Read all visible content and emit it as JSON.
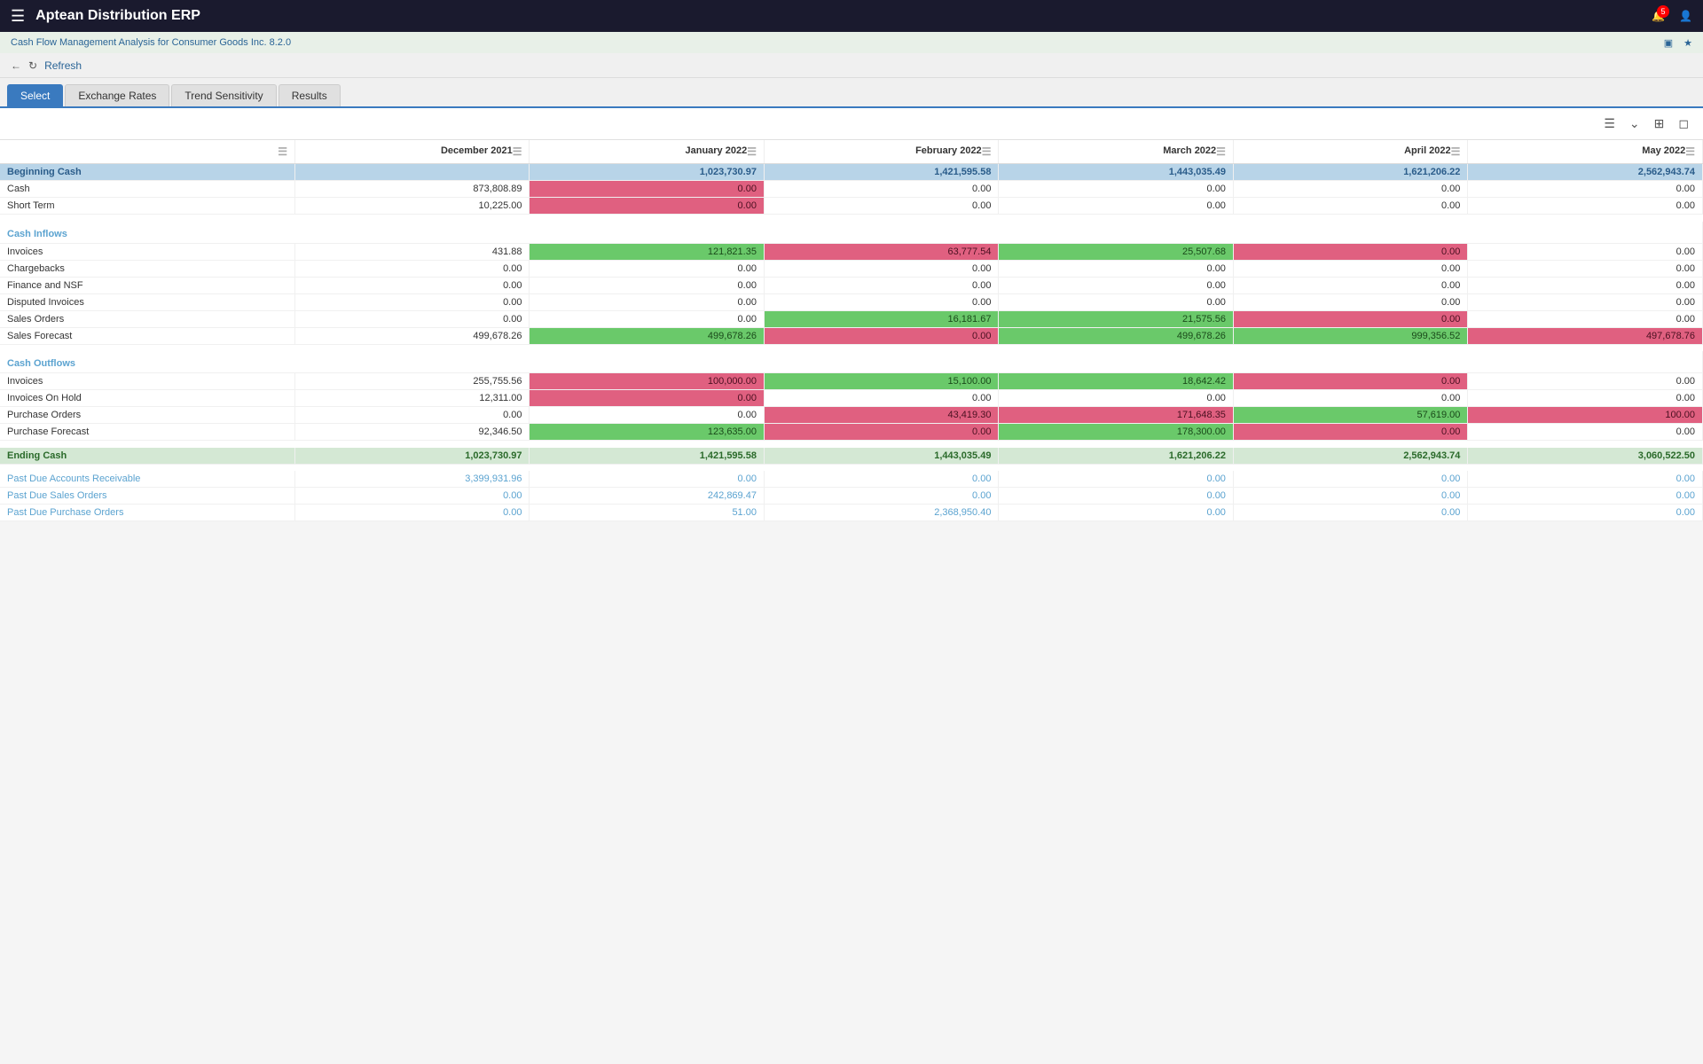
{
  "app": {
    "title": "Aptean Distribution ERP",
    "subtitle": "Cash Flow Management Analysis for Consumer Goods Inc. 8.2.0",
    "refresh_label": "Refresh",
    "notifications_count": "5"
  },
  "tabs": [
    {
      "label": "Select",
      "active": true
    },
    {
      "label": "Exchange Rates",
      "active": false
    },
    {
      "label": "Trend Sensitivity",
      "active": false
    },
    {
      "label": "Results",
      "active": false
    }
  ],
  "columns": [
    {
      "label": "",
      "key": "label"
    },
    {
      "label": "December 2021",
      "key": "dec2021"
    },
    {
      "label": "January 2022",
      "key": "jan2022"
    },
    {
      "label": "February 2022",
      "key": "feb2022"
    },
    {
      "label": "March 2022",
      "key": "mar2022"
    },
    {
      "label": "April 2022",
      "key": "apr2022"
    },
    {
      "label": "May 2022",
      "key": "may2022"
    }
  ],
  "rows": {
    "beginning_cash_label": "Beginning Cash",
    "beginning_cash": [
      "",
      "1,023,730.97",
      "1,421,595.58",
      "1,443,035.49",
      "1,621,206.22",
      "2,562,943.74"
    ],
    "cash_label": "Cash",
    "cash": [
      "873,808.89",
      "0.00",
      "0.00",
      "0.00",
      "0.00",
      "0.00"
    ],
    "short_term_label": "Short Term",
    "short_term": [
      "10,225.00",
      "0.00",
      "0.00",
      "0.00",
      "0.00",
      "0.00"
    ],
    "cash_inflows_label": "Cash Inflows",
    "invoices_in_label": "Invoices",
    "invoices_in": [
      "431.88",
      "121,821.35",
      "63,777.54",
      "25,507.68",
      "0.00",
      "0.00"
    ],
    "chargebacks_label": "Chargebacks",
    "chargebacks": [
      "0.00",
      "0.00",
      "0.00",
      "0.00",
      "0.00",
      "0.00"
    ],
    "finance_nsf_label": "Finance and NSF",
    "finance_nsf": [
      "0.00",
      "0.00",
      "0.00",
      "0.00",
      "0.00",
      "0.00"
    ],
    "disputed_label": "Disputed Invoices",
    "disputed": [
      "0.00",
      "0.00",
      "0.00",
      "0.00",
      "0.00",
      "0.00"
    ],
    "sales_orders_label": "Sales Orders",
    "sales_orders": [
      "0.00",
      "0.00",
      "16,181.67",
      "21,575.56",
      "0.00",
      "0.00"
    ],
    "sales_forecast_label": "Sales Forecast",
    "sales_forecast": [
      "499,678.26",
      "499,678.26",
      "0.00",
      "499,678.26",
      "999,356.52",
      "497,678.76"
    ],
    "cash_outflows_label": "Cash Outflows",
    "invoices_out_label": "Invoices",
    "invoices_out": [
      "255,755.56",
      "100,000.00",
      "15,100.00",
      "18,642.42",
      "0.00",
      "0.00"
    ],
    "invoices_hold_label": "Invoices On Hold",
    "invoices_hold": [
      "12,311.00",
      "0.00",
      "0.00",
      "0.00",
      "0.00",
      "0.00"
    ],
    "purchase_orders_label": "Purchase Orders",
    "purchase_orders": [
      "0.00",
      "0.00",
      "43,419.30",
      "171,648.35",
      "57,619.00",
      "100.00"
    ],
    "purchase_forecast_label": "Purchase Forecast",
    "purchase_forecast": [
      "92,346.50",
      "123,635.00",
      "0.00",
      "178,300.00",
      "0.00",
      "0.00"
    ],
    "ending_cash_label": "Ending Cash",
    "ending_cash": [
      "1,023,730.97",
      "1,421,595.58",
      "1,443,035.49",
      "1,621,206.22",
      "2,562,943.74",
      "3,060,522.50"
    ],
    "past_due_ar_label": "Past Due Accounts Receivable",
    "past_due_ar": [
      "3,399,931.96",
      "0.00",
      "0.00",
      "0.00",
      "0.00",
      "0.00"
    ],
    "past_due_so_label": "Past Due Sales Orders",
    "past_due_so": [
      "0.00",
      "242,869.47",
      "0.00",
      "0.00",
      "0.00",
      "0.00"
    ],
    "past_due_po_label": "Past Due Purchase Orders",
    "past_due_po": [
      "0.00",
      "51.00",
      "2,368,950.40",
      "0.00",
      "0.00",
      "0.00"
    ]
  }
}
